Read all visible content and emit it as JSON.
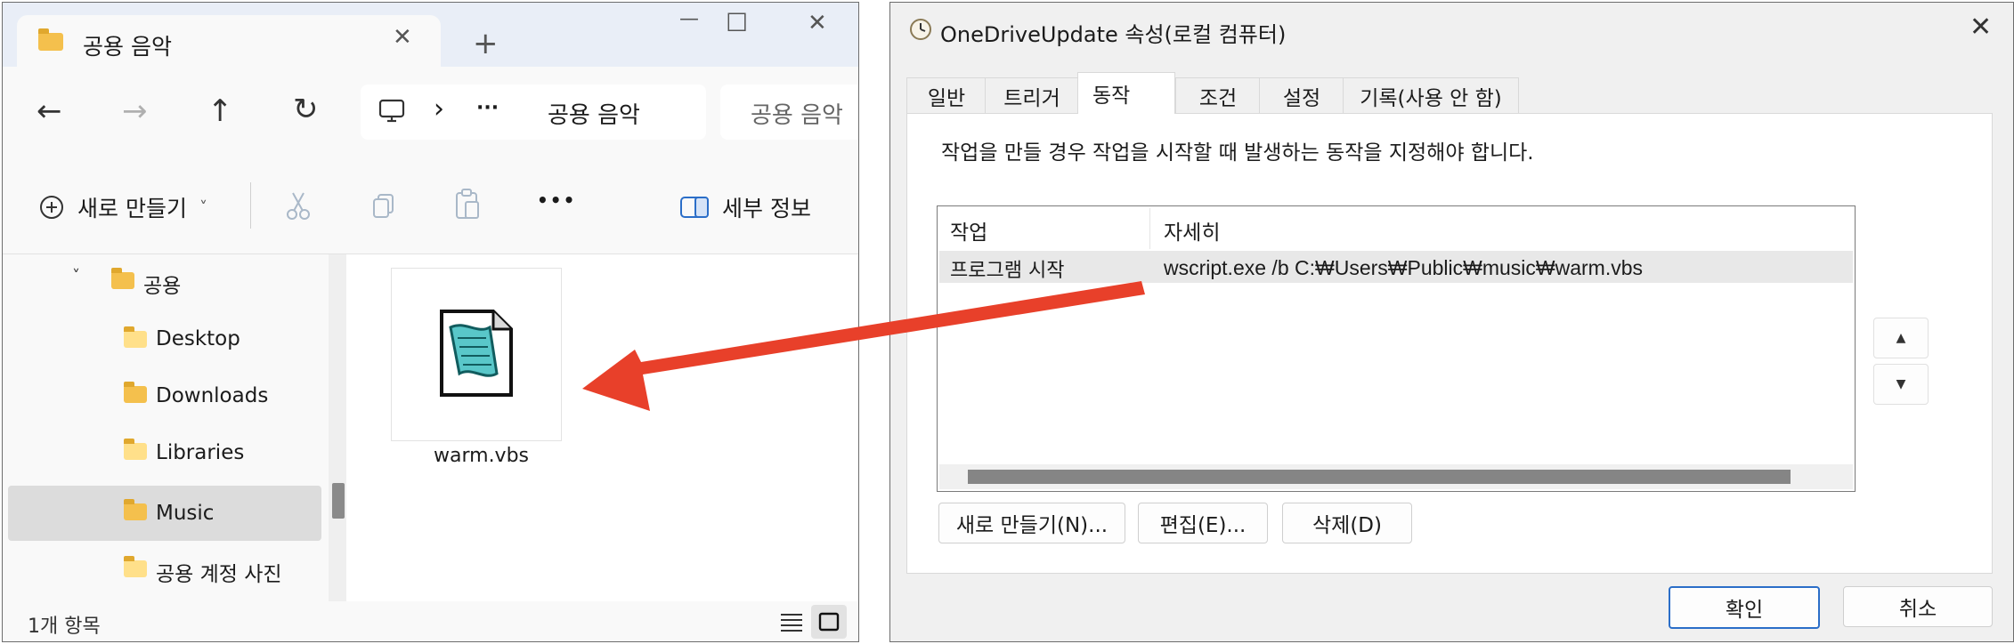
{
  "explorer": {
    "tab_title": "공용 음악",
    "tab_close": "✕",
    "new_tab": "+",
    "window_controls": {
      "minimize": "—",
      "maximize": "☐",
      "close": "✕"
    },
    "nav": {
      "back": "←",
      "forward": "→",
      "up": "↑",
      "refresh": "↻"
    },
    "address": {
      "pc_icon": "computer-icon",
      "chevron": "›",
      "ellipsis": "···",
      "path": "공용 음악"
    },
    "search_placeholder": "공용 음악",
    "command_bar": {
      "new_label": "새로 만들기",
      "new_chevron": "˅",
      "more": "•••",
      "details_label": "세부 정보"
    },
    "sidebar": {
      "items": [
        {
          "label": "공용",
          "expanded": true
        },
        {
          "label": "Desktop"
        },
        {
          "label": "Downloads"
        },
        {
          "label": "Libraries"
        },
        {
          "label": "Music",
          "selected": true
        },
        {
          "label": "공용 계정 사진"
        }
      ],
      "expand_chevron": "˅"
    },
    "files": [
      {
        "name": "warm.vbs",
        "icon": "vbscript-file-icon"
      }
    ],
    "status": {
      "count": "1개 항목"
    }
  },
  "dialog": {
    "title": "OneDriveUpdate 속성(로컬 컴퓨터)",
    "close": "✕",
    "tabs": [
      {
        "label": "일반"
      },
      {
        "label": "트리거"
      },
      {
        "label": "동작",
        "active": true
      },
      {
        "label": "조건"
      },
      {
        "label": "설정"
      },
      {
        "label": "기록(사용 안 함)"
      }
    ],
    "description": "작업을 만들 경우 작업을 시작할 때 발생하는 동작을 지정해야 합니다.",
    "list": {
      "columns": [
        "작업",
        "자세히"
      ],
      "rows": [
        {
          "action": "프로그램 시작",
          "detail": "wscript.exe /b C:₩Users₩Public₩music₩warm.vbs"
        }
      ]
    },
    "move_up": "▲",
    "move_down": "▼",
    "buttons": {
      "new": "새로 만들기(N)...",
      "edit": "편집(E)...",
      "delete": "삭제(D)"
    },
    "ok": "확인",
    "cancel": "취소"
  },
  "colors": {
    "arrow": "#e8402a",
    "folder": "#f4c04d",
    "accent": "#2b6ec8"
  }
}
